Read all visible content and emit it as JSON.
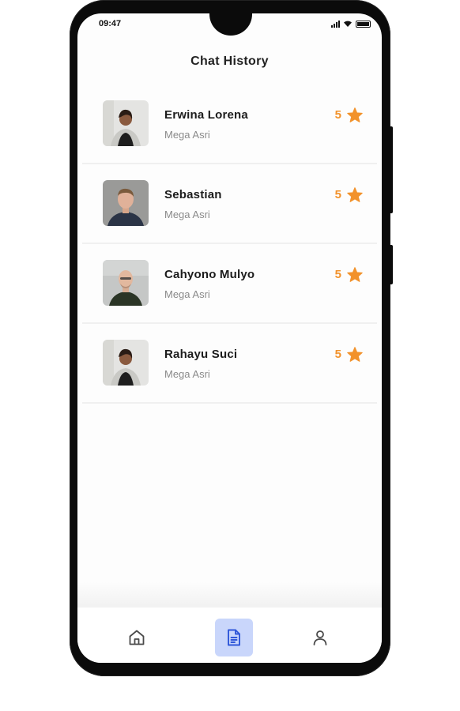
{
  "status_bar": {
    "time": "09:47"
  },
  "header": {
    "title": "Chat History"
  },
  "chats": [
    {
      "name": "Erwina Lorena",
      "subtitle": "Mega Asri",
      "rating": "5",
      "avatar": "woman-avatar"
    },
    {
      "name": "Sebastian",
      "subtitle": "Mega Asri",
      "rating": "5",
      "avatar": "man-avatar"
    },
    {
      "name": "Cahyono Mulyo",
      "subtitle": "Mega Asri",
      "rating": "5",
      "avatar": "bald-man-avatar"
    },
    {
      "name": "Rahayu Suci",
      "subtitle": "Mega Asri",
      "rating": "5",
      "avatar": "woman-avatar"
    }
  ],
  "bottom_nav": {
    "items": [
      {
        "icon": "home-icon",
        "active": false
      },
      {
        "icon": "document-icon",
        "active": true
      },
      {
        "icon": "profile-icon",
        "active": false
      }
    ]
  },
  "colors": {
    "accent": "#f2922b",
    "nav_active_bg": "#c9d6fb",
    "nav_active_icon": "#2f57d9"
  }
}
